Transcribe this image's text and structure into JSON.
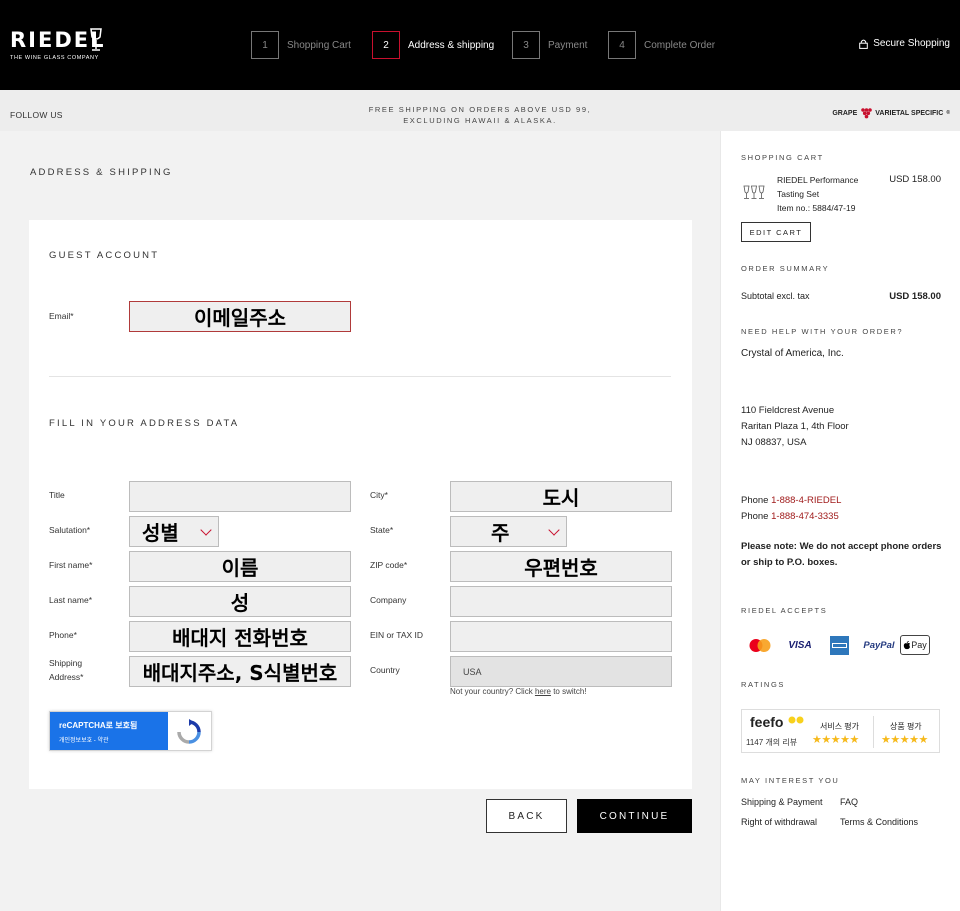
{
  "header": {
    "logo": "RIEDEL",
    "logo_tagline": "THE WINE GLASS COMPANY",
    "steps": [
      {
        "num": "1",
        "label": "Shopping Cart"
      },
      {
        "num": "2",
        "label": "Address & shipping"
      },
      {
        "num": "3",
        "label": "Payment"
      },
      {
        "num": "4",
        "label": "Complete Order"
      }
    ],
    "active_step": 2,
    "secure": "Secure Shopping"
  },
  "strip": {
    "follow": "FOLLOW US",
    "promo": "FREE SHIPPING ON ORDERS ABOVE USD 99, EXCLUDING HAWAII & ALASKA.",
    "grape_left": "GRAPE",
    "grape_right": "VARIETAL SPECIFIC",
    "grape_mark": "®"
  },
  "main": {
    "heading": "ADDRESS & SHIPPING",
    "guest_heading": "GUEST ACCOUNT",
    "email_label": "Email*",
    "email_value": "이메일주소",
    "fill_heading": "FILL IN YOUR ADDRESS DATA",
    "left_fields": [
      {
        "label": "Title",
        "value": ""
      },
      {
        "label": "Salutation*",
        "value": "성별"
      },
      {
        "label": "First name*",
        "value": "이름"
      },
      {
        "label": "Last name*",
        "value": "성"
      },
      {
        "label": "Phone*",
        "value": "배대지 전화번호"
      },
      {
        "label": "Shipping Address*",
        "value": "배대지주소, S식별번호"
      }
    ],
    "right_fields": [
      {
        "label": "City*",
        "value": "도시"
      },
      {
        "label": "State*",
        "value": "주"
      },
      {
        "label": "ZIP code*",
        "value": "우편번호"
      },
      {
        "label": "Company",
        "value": ""
      },
      {
        "label": "EIN or TAX ID",
        "value": ""
      },
      {
        "label": "Country",
        "value": "USA"
      }
    ],
    "switch_text": "Not your country? Click",
    "switch_link": "here",
    "switch_tail": "to switch!",
    "recaptcha_title": "reCAPTCHA로 보호됨",
    "recaptcha_sub": "개인정보보호 - 약관",
    "back": "BACK",
    "continue": "CONTINUE"
  },
  "sidebar": {
    "cart_heading": "SHOPPING CART",
    "item_name": "RIEDEL Performance Tasting Set",
    "item_no": "Item no.: 5884/47-19",
    "item_price": "USD 158.00",
    "edit_cart": "EDIT CART",
    "summary_heading": "ORDER SUMMARY",
    "subtotal_label": "Subtotal excl. tax",
    "subtotal_value": "USD 158.00",
    "help_heading": "NEED HELP WITH YOUR ORDER?",
    "company": "Crystal of America, Inc.",
    "address1": "110 Fieldcrest Avenue",
    "address2": "Raritan Plaza 1, 4th Floor",
    "address3": "NJ 08837, USA",
    "phone_label": "Phone",
    "phone1": "1-888-4-RIEDEL",
    "phone2": "1-888-474-3335",
    "note": "Please note: We do not accept phone orders or ship to P.O. boxes.",
    "accepts_heading": "RIEDEL ACCEPTS",
    "payments": [
      "mastercard",
      "VISA",
      "AMEX",
      "PayPal",
      "Pay"
    ],
    "ratings_heading": "RATINGS",
    "feefo": "feefo",
    "reviews": "1147 개의 리뷰",
    "service_rating": "서비스 평가",
    "product_rating": "상품 평가",
    "service_stars": 5,
    "product_stars": 5,
    "interest_heading": "MAY INTEREST YOU",
    "link1": "Shipping & Payment",
    "link2": "FAQ",
    "link3": "Right of withdrawal",
    "link4": "Terms & Conditions"
  }
}
